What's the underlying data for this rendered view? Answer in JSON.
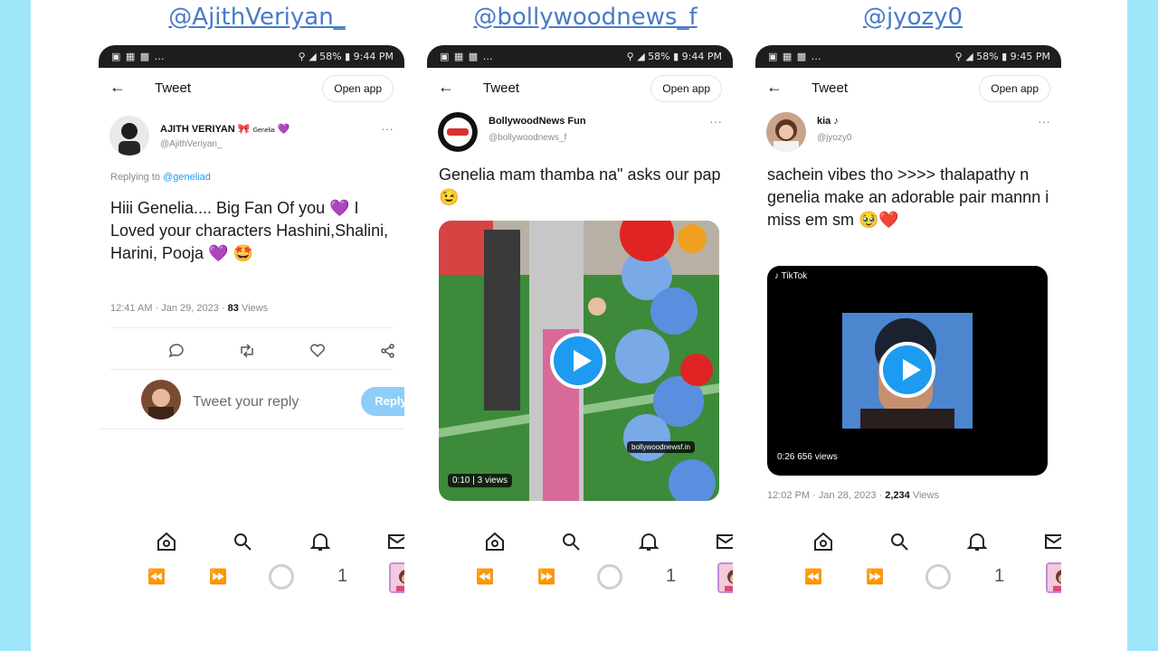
{
  "handles": [
    "@AjithVeriyan_",
    "@bollywoodnews_f",
    "@jyozy0"
  ],
  "colors": {
    "background": "#9fe6fa",
    "handle_link": "#4a7ac9",
    "accent": "#1d9bf0",
    "reply_button": "#8ecdf8",
    "heart": "#e0245e"
  },
  "phones": [
    {
      "status_time": "9:44 PM",
      "status_battery": "58%",
      "topbar": {
        "title": "Tweet",
        "open_app": "Open app"
      },
      "author": {
        "name": "AJITH VERIYAN",
        "tag": "Genelia",
        "handle": "@AjithVeriyan_"
      },
      "replying_prefix": "Replying to",
      "replying_handle": "@geneliad",
      "text": "Hiii Genelia.... Big Fan Of you 💜 I Loved your characters Hashini,Shalini, Harini, Pooja 💜 🤩",
      "meta_time": "12:41 AM · Jan 29, 2023 · ",
      "meta_views": "83",
      "meta_views_label": " Views",
      "reply_placeholder": "Tweet your reply",
      "reply_button": "Reply",
      "sys_count": "1"
    },
    {
      "status_time": "9:44 PM",
      "status_battery": "58%",
      "topbar": {
        "title": "Tweet",
        "open_app": "Open app"
      },
      "author": {
        "name": "BollywoodNews Fun",
        "handle": "@bollywoodnews_f"
      },
      "text": "Genelia mam thamba na\" asks our pap 😉",
      "video": {
        "duration": "0:10",
        "views": "3 views",
        "watermark": "bollywoodnewsf.in"
      },
      "sys_count": "1"
    },
    {
      "status_time": "9:45 PM",
      "status_battery": "58%",
      "topbar": {
        "title": "Tweet",
        "open_app": "Open app"
      },
      "author": {
        "name": "kia ♪",
        "handle": "@jyozy0"
      },
      "text": "sachein vibes tho >>>> thalapathy n genelia make an adorable pair mannn i miss em sm 🥹❤️",
      "video": {
        "duration": "0:26",
        "views": "656 views",
        "watermark": "TikTok"
      },
      "meta_time": "12:02 PM · Jan 28, 2023 · ",
      "meta_views": "2,234",
      "meta_views_label": " Views",
      "sys_count": "1"
    }
  ]
}
